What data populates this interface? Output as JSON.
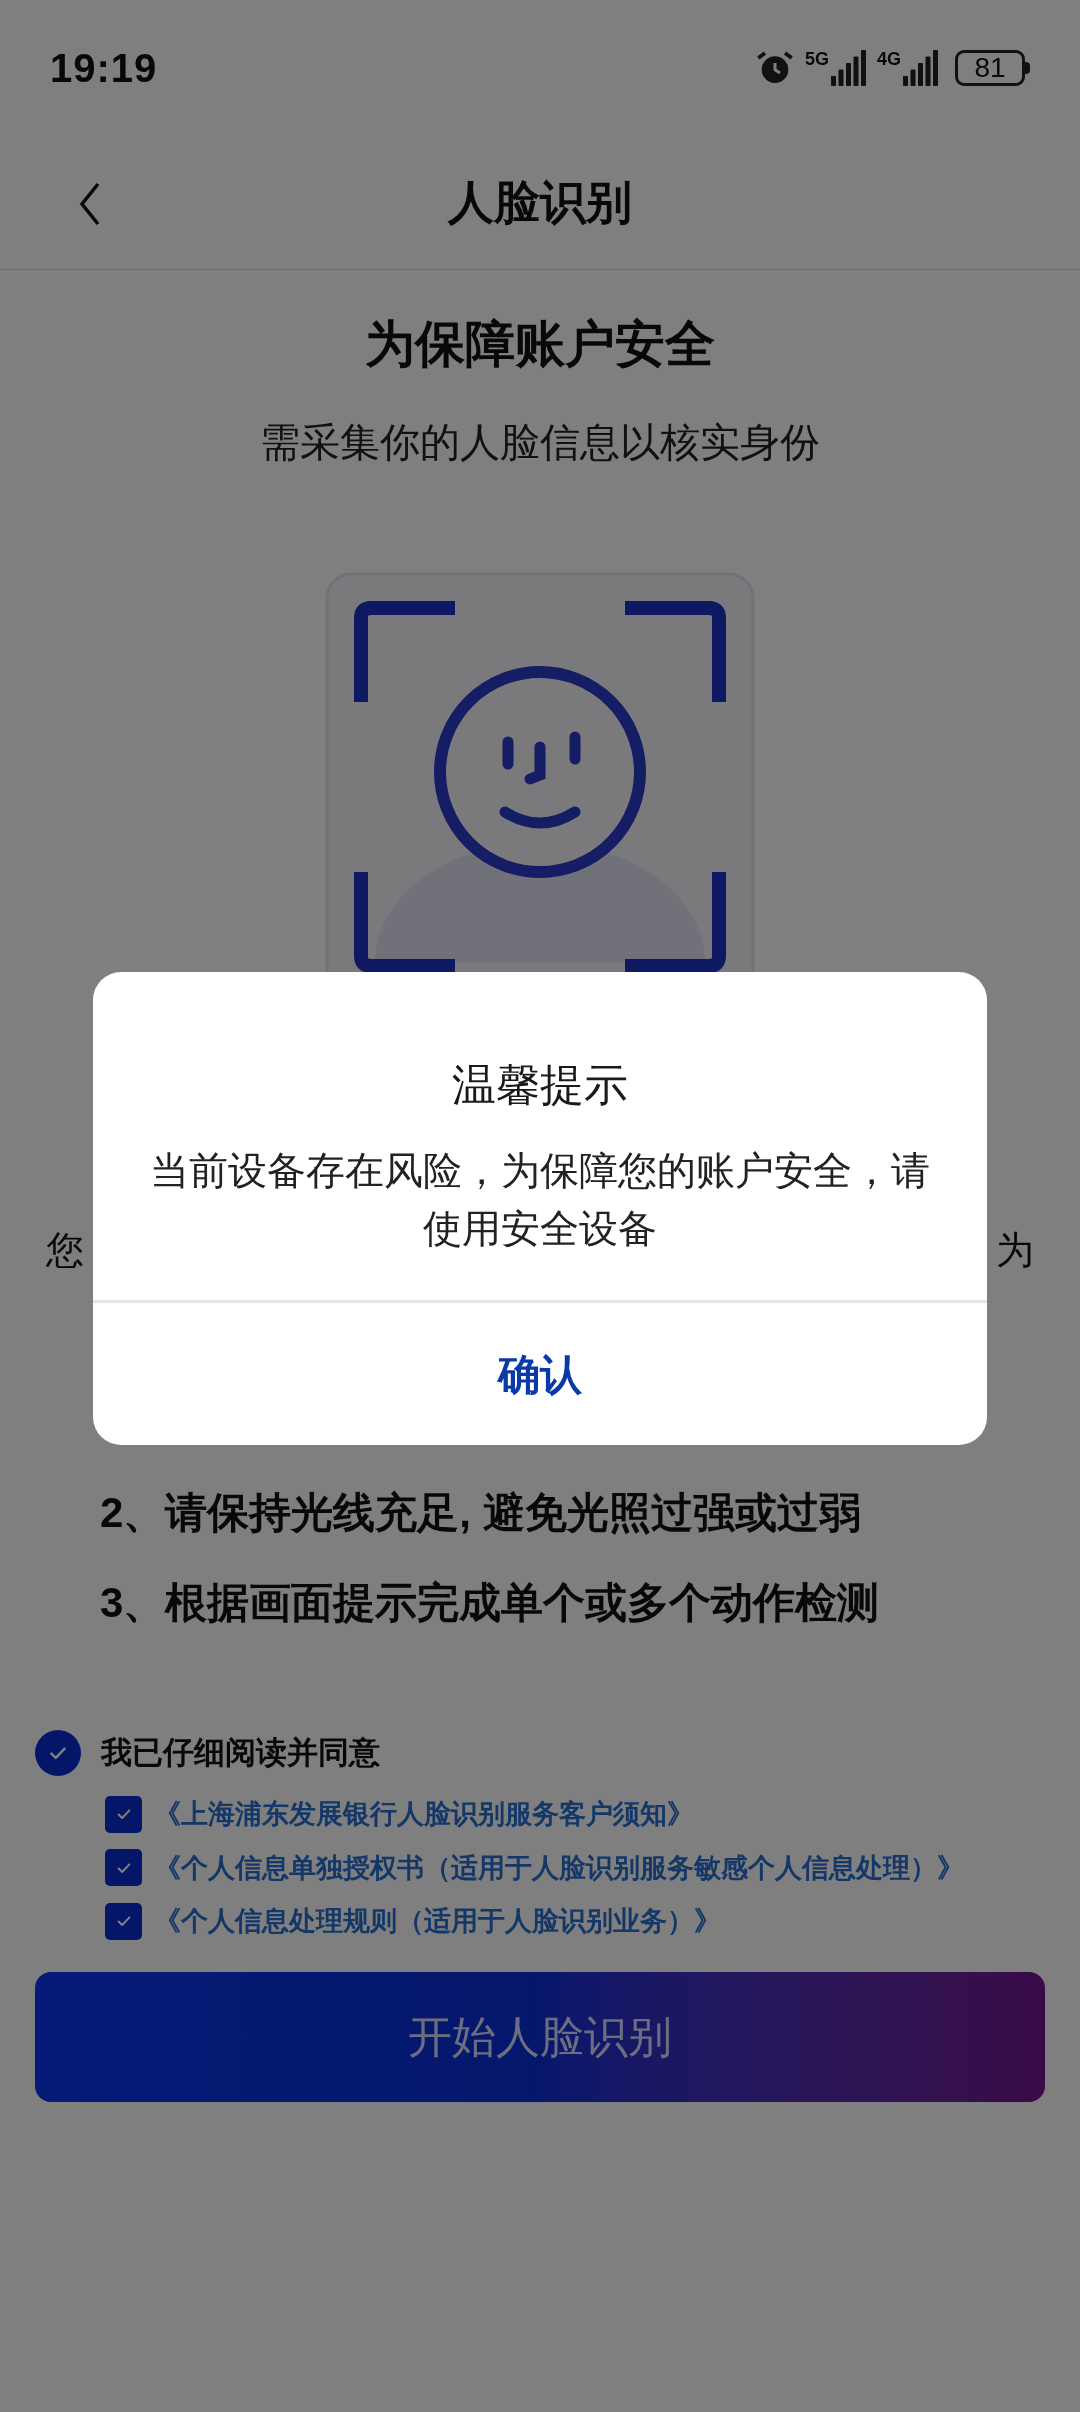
{
  "status_bar": {
    "time": "19:19",
    "network_labels": [
      "5G",
      "4G"
    ],
    "battery": "81"
  },
  "nav": {
    "title": "人脸识别"
  },
  "intro": {
    "heading": "为保障账户安全",
    "subtitle": "需采集你的人脸信息以核实身份"
  },
  "notice_fragments": {
    "left": "您",
    "right": "为"
  },
  "tips": [
    "2、请保持光线充足, 避免光照过强或过弱",
    "3、根据画面提示完成单个或多个动作检测"
  ],
  "agreement": {
    "label": "我已仔细阅读并同意",
    "checked": true,
    "documents": [
      {
        "title": "《上海浦东发展银行人脸识别服务客户须知》",
        "checked": true
      },
      {
        "title": "《个人信息单独授权书（适用于人脸识别服务敏感个人信息处理）》",
        "checked": true
      },
      {
        "title": "《个人信息处理规则（适用于人脸识别业务）》",
        "checked": true
      }
    ]
  },
  "start_button": {
    "label": "开始人脸识别"
  },
  "dialog": {
    "title": "温馨提示",
    "message": "当前设备存在风险，为保障您的账户安全，请使用安全设备",
    "confirm": "确认"
  }
}
